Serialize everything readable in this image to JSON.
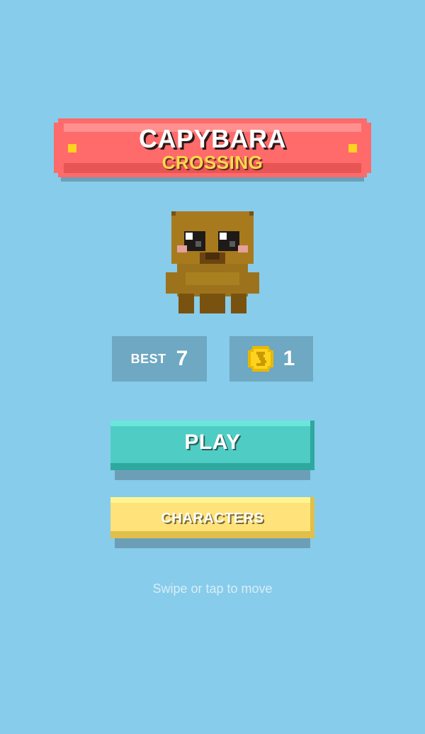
{
  "title": {
    "main": "CAPYBARA",
    "sub": "CROSSING"
  },
  "character": {
    "icon": "capybara-pixel-sprite"
  },
  "stats": {
    "best_label": "BEST",
    "best_value": "7",
    "coin_icon": "coin-icon",
    "coins_value": "1"
  },
  "buttons": {
    "play_label": "PLAY",
    "characters_label": "CHARACTERS"
  },
  "hint": "Swipe or tap to move",
  "colors": {
    "background": "#87CCEA",
    "banner": "#FF6A6A",
    "play_button": "#4FCDC4",
    "characters_button": "#FFE27A",
    "stat_panel": "#6EA8C2",
    "coin": "#FFD21F"
  }
}
